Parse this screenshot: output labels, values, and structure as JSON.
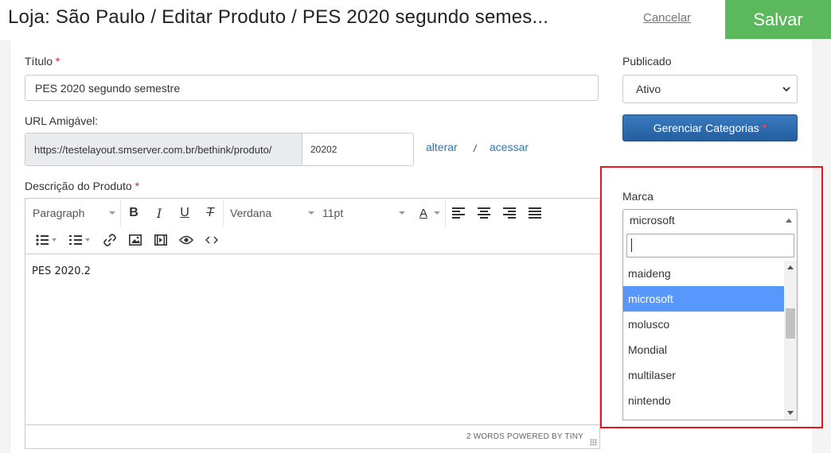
{
  "header": {
    "title": "Loja: São Paulo / Editar Produto /  PES 2020 segundo semes...",
    "cancel_label": "Cancelar",
    "save_label": "Salvar"
  },
  "form": {
    "title_label": "Título",
    "title_value": "PES 2020 segundo semestre",
    "url_label": "URL Amigável:",
    "url_prefix": "https://testelayout.smserver.com.br/bethink/produto/",
    "url_slug": "20202",
    "url_change_label": "alterar",
    "url_separator": "/",
    "url_access_label": "acessar",
    "description_label": "Descrição do Produto",
    "required_marker": "*"
  },
  "editor": {
    "block_format": "Paragraph",
    "font_family": "Verdana",
    "font_size": "11pt",
    "content": "PES 2020.2",
    "status": "2 WORDS POWERED BY TINY"
  },
  "sidebar": {
    "published_label": "Publicado",
    "published_value": "Ativo",
    "categories_button": "Gerenciar Categorias",
    "brand_label": "Marca",
    "brand_value": "microsoft",
    "brand_search_value": "",
    "brand_options": [
      "maideng",
      "microsoft",
      "molusco",
      "Mondial",
      "multilaser",
      "nintendo"
    ],
    "brand_selected_index": 1
  },
  "colors": {
    "save": "#5cb85c",
    "primary": "#2a6bb0",
    "highlight": "#e8161d",
    "selected_option": "#5897fb",
    "required": "#d9232d"
  }
}
